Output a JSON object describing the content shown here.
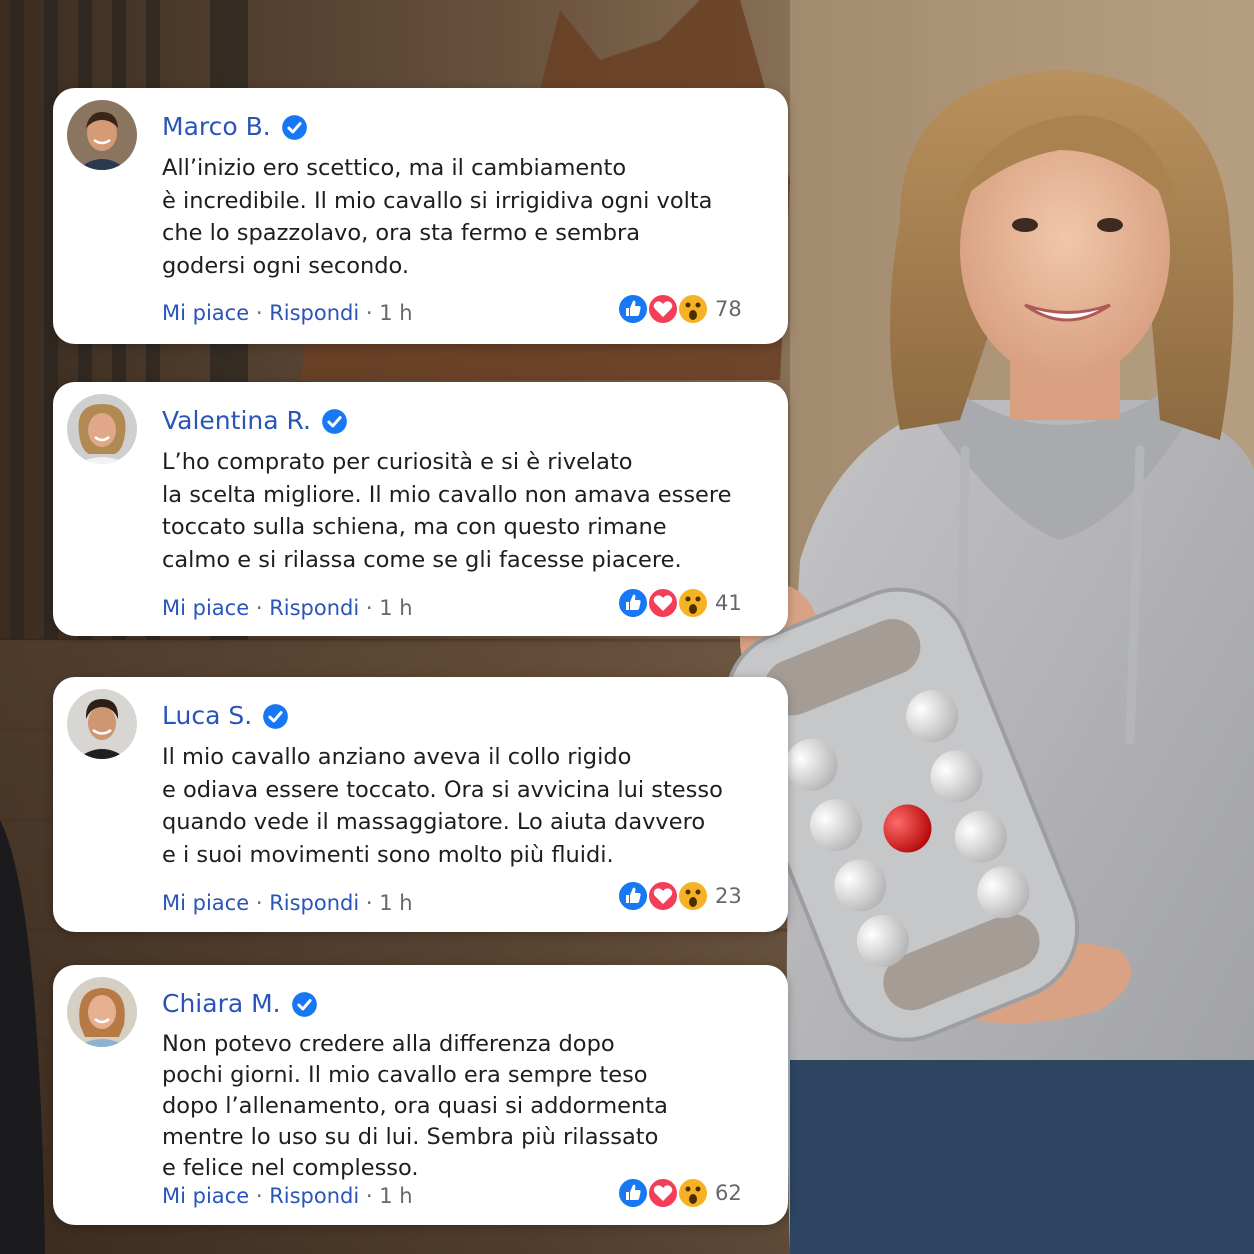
{
  "comments": [
    {
      "name": "Marco B.",
      "text_lines": [
        "All’inizio ero scettico, ma il cambiamento",
        "è incredibile. Il mio cavallo si irrigidiva ogni volta",
        "che lo spazzolavo, ora sta fermo e sembra",
        "godersi ogni secondo."
      ],
      "like_label": "Mi piace",
      "reply_label": "Rispondi",
      "time": "1 h",
      "reaction_count": "78"
    },
    {
      "name": "Valentina R.",
      "text_lines": [
        "L’ho comprato per curiosità e si è rivelato",
        "la scelta migliore. Il mio cavallo non amava essere",
        "toccato sulla schiena, ma con questo rimane",
        "calmo e si rilassa come se gli facesse piacere."
      ],
      "like_label": "Mi piace",
      "reply_label": "Rispondi",
      "time": "1 h",
      "reaction_count": "41"
    },
    {
      "name": "Luca S.",
      "text_lines": [
        "Il mio cavallo anziano aveva il collo rigido",
        "e odiava essere toccato. Ora si avvicina lui stesso",
        "quando vede il massaggiatore. Lo aiuta davvero",
        "e i suoi movimenti sono molto più fluidi."
      ],
      "like_label": "Mi piace",
      "reply_label": "Rispondi",
      "time": "1 h",
      "reaction_count": "23"
    },
    {
      "name": "Chiara M.",
      "text_lines": [
        "Non potevo credere alla differenza dopo",
        "pochi giorni. Il mio cavallo era sempre teso",
        "dopo l’allenamento, ora quasi si addormenta",
        "mentre lo uso su di lui. Sembra più rilassato",
        "e felice nel complesso."
      ],
      "like_label": "Mi piace",
      "reply_label": "Rispondi",
      "time": "1 h",
      "reaction_count": "62"
    }
  ],
  "separator": "·",
  "icons": {
    "verified": "verified-check-icon",
    "reactions": [
      "like-icon",
      "love-icon",
      "wow-icon"
    ]
  },
  "colors": {
    "name_link": "#2a55b8",
    "verified_badge": "#1877f2",
    "like": "#1877f2",
    "love": "#f33e58",
    "wow": "#f7b125",
    "meta_gray": "#65676b"
  }
}
